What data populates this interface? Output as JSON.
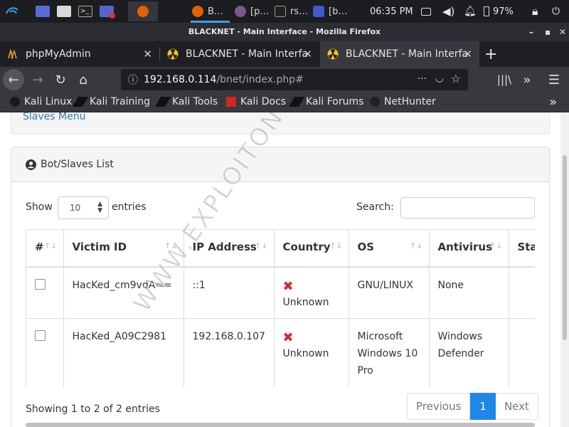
{
  "taskbar": {
    "apps": [
      {
        "label": "B…"
      },
      {
        "label": "[p…"
      },
      {
        "label": "rs…"
      },
      {
        "label": "[b…"
      }
    ],
    "clock": "06:35 PM",
    "battery": "97%"
  },
  "window": {
    "title": "BLACKNET - Main Interface - Mozilla Firefox"
  },
  "tabs": [
    {
      "label": "phpMyAdmin"
    },
    {
      "label": "BLACKNET - Main Interfa"
    },
    {
      "label": "BLACKNET - Main Interfa"
    }
  ],
  "url": {
    "host": "192.168.0.114",
    "path": "/bnet/index.php#"
  },
  "bookmarks": [
    {
      "label": "Kali Linux"
    },
    {
      "label": "Kali Training"
    },
    {
      "label": "Kali Tools"
    },
    {
      "label": "Kali Docs"
    },
    {
      "label": "Kali Forums"
    },
    {
      "label": "NetHunter"
    }
  ],
  "page": {
    "slaves_menu": "Slaves Menu",
    "panel_title": "Bot/Slaves List",
    "show_label": "Show",
    "entries_value": "10",
    "entries_label": "entries",
    "search_label": "Search:",
    "columns": [
      "#",
      "Victim ID",
      "IP Address",
      "Country",
      "OS",
      "Antivirus",
      "Sta"
    ],
    "rows": [
      {
        "victim_id": "HacKed_cm9vdA==",
        "ip": "::1",
        "country": "Unknown",
        "os": "GNU/LINUX",
        "antivirus": "None"
      },
      {
        "victim_id": "HacKed_A09C2981",
        "ip": "192.168.0.107",
        "country": "Unknown",
        "os": "Microsoft Windows 10 Pro",
        "antivirus": "Windows Defender"
      }
    ],
    "footer": "Showing 1 to 2 of 2 entries",
    "pager": {
      "previous": "Previous",
      "current": "1",
      "next": "Next"
    },
    "watermark": "WWW.EXPLOITONE.COM"
  },
  "colors": {
    "link": "#337ab7",
    "pager_active": "#1f87e5",
    "flag_x": "#d9262d"
  }
}
